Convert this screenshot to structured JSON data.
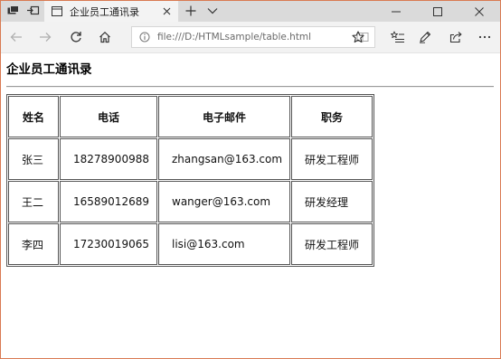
{
  "browser": {
    "tab": {
      "title": "企业员工通讯录"
    },
    "address_bar": {
      "url": "file:///D:/HTMLsample/table.html"
    }
  },
  "page": {
    "heading": "企业员工通讯录",
    "table": {
      "headers": [
        "姓名",
        "电话",
        "电子邮件",
        "职务"
      ],
      "rows": [
        [
          "张三",
          "18278900988",
          "zhangsan@163.com",
          "研发工程师"
        ],
        [
          "王二",
          "16589012689",
          "wanger@163.com",
          "研发经理"
        ],
        [
          "李四",
          "17230019065",
          "lisi@163.com",
          "研发工程师"
        ]
      ]
    }
  },
  "colors": {
    "accent_border": "#d97a52",
    "titlebar_bg": "#dadada",
    "navbar_bg": "#f2f2f2"
  },
  "icons": {
    "titlebar_left": [
      "tab-actions-icon",
      "set-aside-tabs-icon"
    ],
    "tab_favicon": "page-icon",
    "tab_close": "close-icon",
    "new_tab": "plus-icon",
    "tabs_menu": "chevron-down-icon",
    "window_controls": [
      "minimize-icon",
      "maximize-icon",
      "close-window-icon"
    ],
    "nav": [
      "back-arrow-icon",
      "forward-arrow-icon",
      "refresh-icon",
      "home-icon"
    ],
    "address": [
      "info-icon",
      "reading-view-icon"
    ],
    "toolbar_right": [
      "favorite-star-icon",
      "favorites-list-icon",
      "pen-notes-icon",
      "share-icon",
      "more-icon"
    ]
  }
}
